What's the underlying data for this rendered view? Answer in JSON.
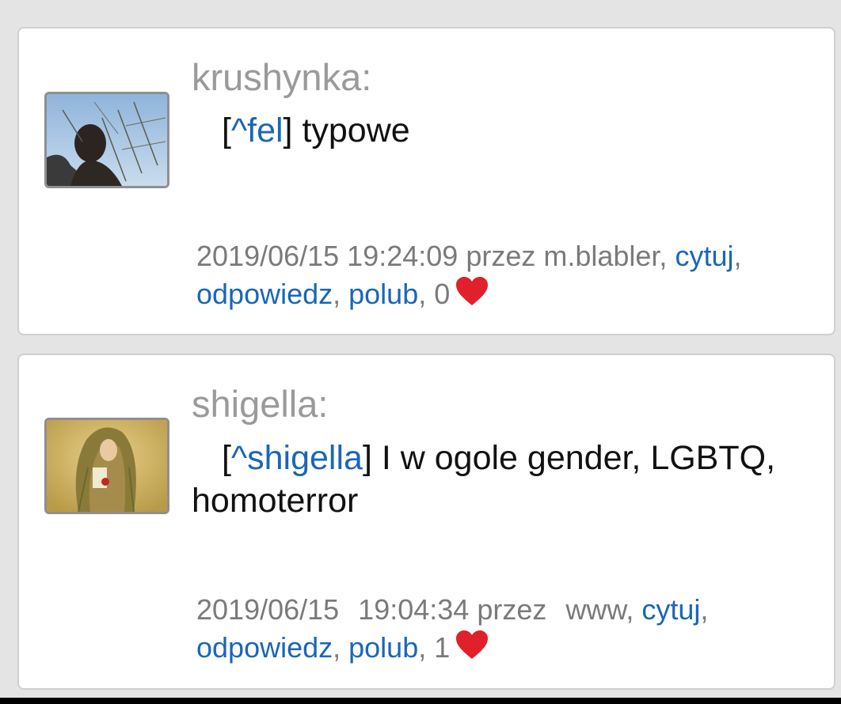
{
  "posts": [
    {
      "author": "krushynka:",
      "reply_open": "[",
      "reply_to": "^fel",
      "reply_close": "]",
      "text": " typowe",
      "timestamp": "2019/06/15 19:24:09",
      "by_label": "przez m.blabler,",
      "quote_label": "cytuj",
      "reply_label": "odpowiedz",
      "like_label": "polub",
      "like_count": "0",
      "heart_color": "#e0202a"
    },
    {
      "author": "shigella:",
      "reply_open": "[",
      "reply_to": "^shigella",
      "reply_close": "]",
      "text": " I w ogole gender, LGBTQ, homoterror",
      "timestamp": "2019/06/15 19:04:34",
      "by_label": "przez www,",
      "quote_label": "cytuj",
      "reply_label": "odpowiedz",
      "like_label": "polub",
      "like_count": "1",
      "heart_color": "#e0202a"
    }
  ],
  "colors": {
    "link": "#1a66b8",
    "author": "#9a9a9a",
    "meta": "#7a7a7a",
    "background": "#e4e4e4"
  }
}
